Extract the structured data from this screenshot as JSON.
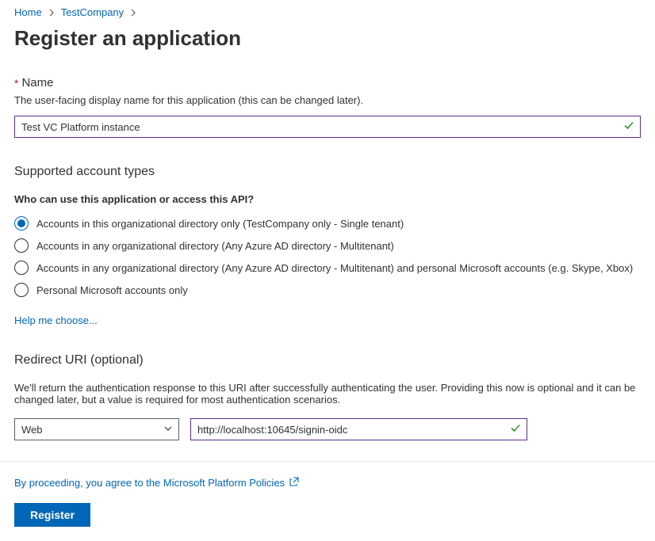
{
  "breadcrumb": {
    "home": "Home",
    "company": "TestCompany"
  },
  "page_title": "Register an application",
  "name_section": {
    "label": "Name",
    "description": "The user-facing display name for this application (this can be changed later).",
    "value": "Test VC Platform instance"
  },
  "account_types": {
    "heading": "Supported account types",
    "sub_label": "Who can use this application or access this API?",
    "options": [
      "Accounts in this organizational directory only (TestCompany only - Single tenant)",
      "Accounts in any organizational directory (Any Azure AD directory - Multitenant)",
      "Accounts in any organizational directory (Any Azure AD directory - Multitenant) and personal Microsoft accounts (e.g. Skype, Xbox)",
      "Personal Microsoft accounts only"
    ],
    "help_link": "Help me choose..."
  },
  "redirect_uri": {
    "heading": "Redirect URI (optional)",
    "description": "We'll return the authentication response to this URI after successfully authenticating the user. Providing this now is optional and it can be changed later, but a value is required for most authentication scenarios.",
    "platform": "Web",
    "uri": "http://localhost:10645/signin-oidc"
  },
  "footer": {
    "policy_text": "By proceeding, you agree to the Microsoft Platform Policies",
    "register_button": "Register"
  }
}
